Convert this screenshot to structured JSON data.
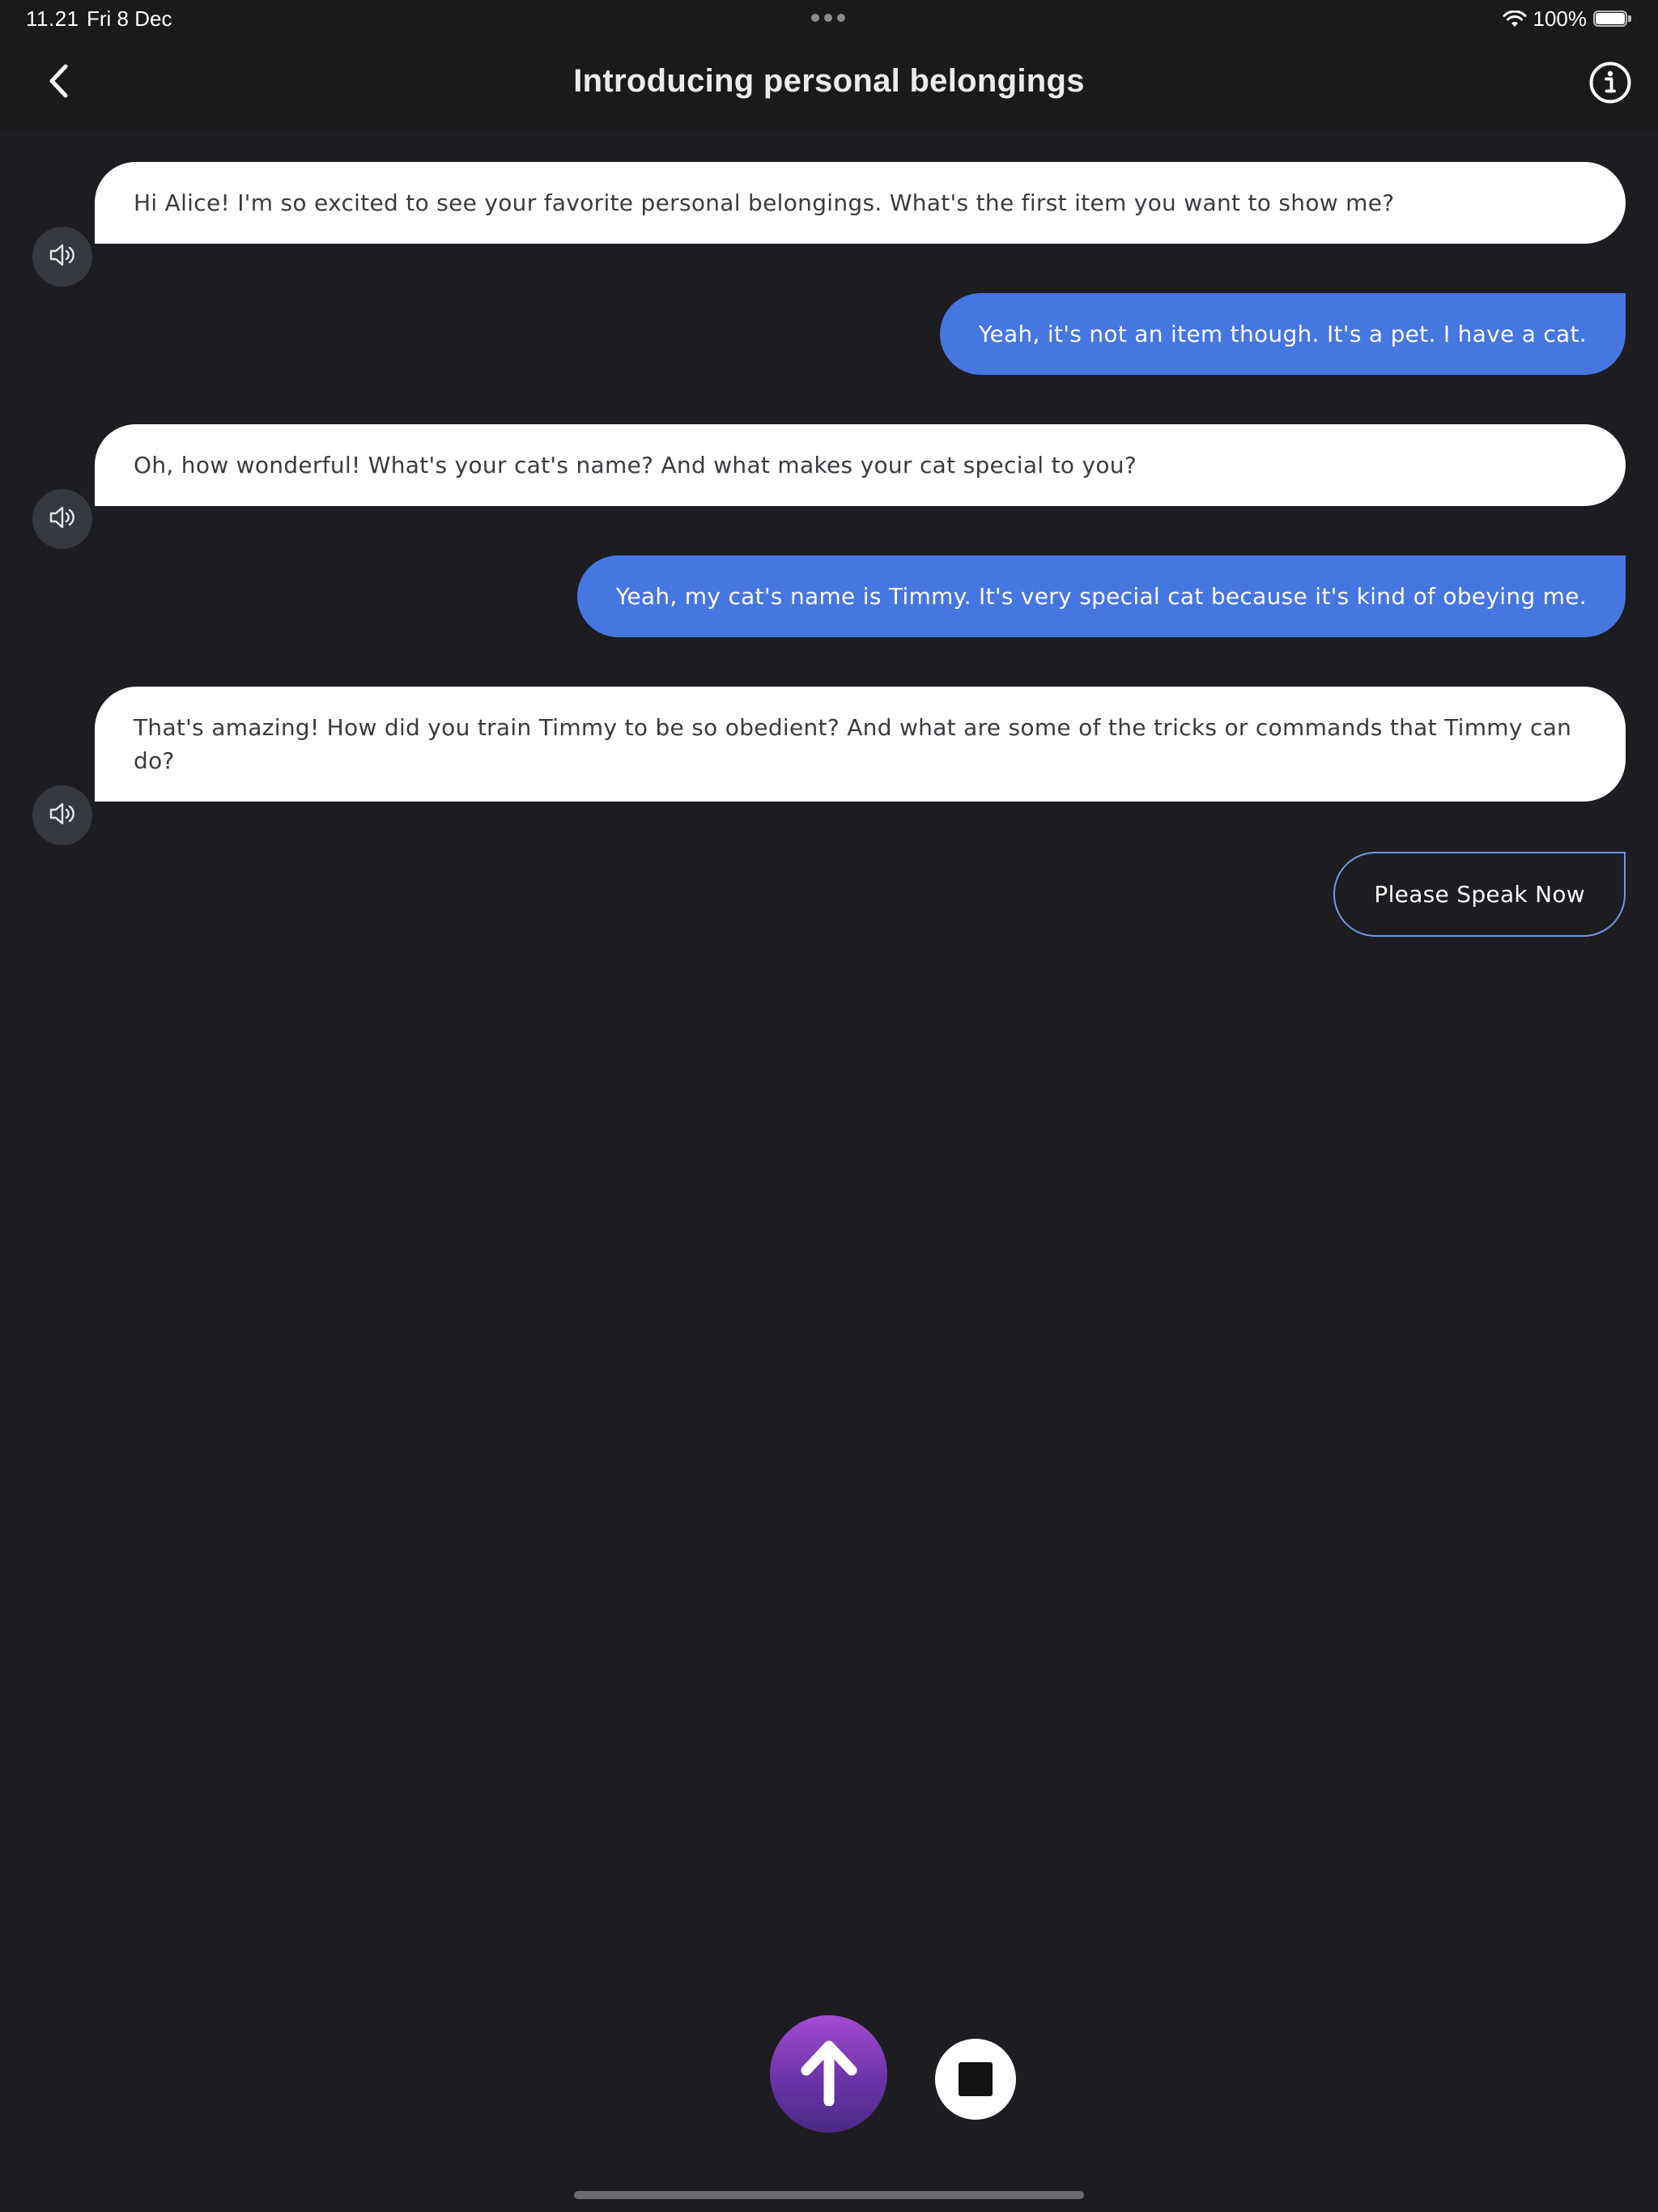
{
  "status_bar": {
    "time": "11.21",
    "date": "Fri 8 Dec",
    "battery_text": "100%",
    "battery_level": 1.0
  },
  "header": {
    "title": "Introducing personal belongings",
    "back_icon": "chevron-left-icon",
    "info_icon": "info-circle-icon"
  },
  "messages": [
    {
      "role": "assistant",
      "text": "Hi Alice! I'm so excited to see your favorite personal belongings. What's the first item you want to show me?"
    },
    {
      "role": "user",
      "text": "Yeah, it's not an item though. It's a pet. I have a cat."
    },
    {
      "role": "assistant",
      "text": "Oh, how wonderful! What's your cat's name? And what makes your cat special to you?"
    },
    {
      "role": "user",
      "text": "Yeah, my cat's name is Timmy. It's very special cat because it's kind of obeying me."
    },
    {
      "role": "assistant",
      "text": "That's amazing! How did you train Timmy to be so obedient? And what are some of the tricks or commands that Timmy can do?"
    }
  ],
  "prompt": {
    "text": "Please Speak Now"
  },
  "controls": {
    "send_icon": "arrow-up-icon",
    "stop_icon": "stop-icon"
  },
  "colors": {
    "background": "#1c1c21",
    "header_background": "#1b1a18",
    "assistant_bubble": "#ffffff",
    "user_bubble": "#4676e0",
    "prompt_border": "#6f9ae0",
    "send_button": "#8a3fc0"
  }
}
